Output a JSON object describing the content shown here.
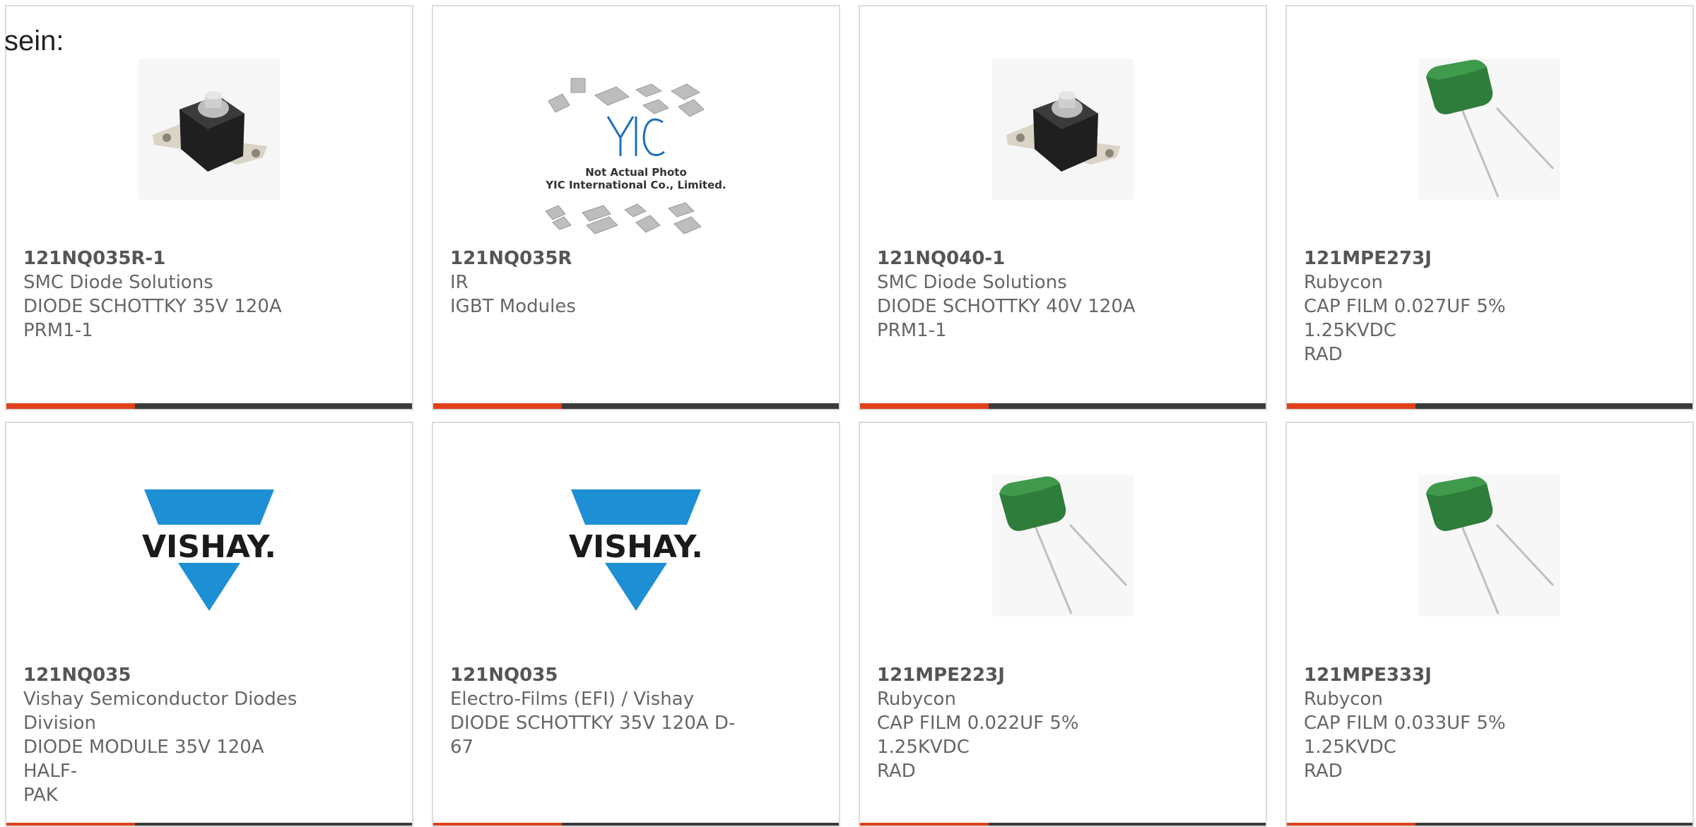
{
  "page": {
    "fragment_text": "sein:"
  },
  "products": [
    {
      "part_number": "121NQ035R-1",
      "manufacturer": "SMC Diode Solutions",
      "desc1": "DIODE SCHOTTKY 35V 120A",
      "desc2": "PRM1-1",
      "image": "diode-module-photo"
    },
    {
      "part_number": "121NQ035R",
      "manufacturer": "IR",
      "desc1": "IGBT Modules",
      "desc2": "",
      "image": "placeholder-photo",
      "image_caption": "Not Actual Photo",
      "image_caption2": "YIC International Co., Limited.",
      "image_logo": "YIC"
    },
    {
      "part_number": "121NQ040-1",
      "manufacturer": "SMC Diode Solutions",
      "desc1": "DIODE SCHOTTKY 40V 120A",
      "desc2": "PRM1-1",
      "image": "diode-module-photo"
    },
    {
      "part_number": "121MPE273J",
      "manufacturer": "Rubycon",
      "desc1": "CAP FILM 0.027UF 5% 1.25KVDC",
      "desc2": "RAD",
      "image": "film-capacitor-photo"
    },
    {
      "part_number": "121NQ035",
      "manufacturer": "Vishay Semiconductor Diodes",
      "manufacturer2": "Division",
      "desc1": "DIODE MODULE 35V 120A HALF-",
      "desc2": "PAK",
      "image": "vishay-logo",
      "logo_text": "VISHAY."
    },
    {
      "part_number": "121NQ035",
      "manufacturer": "Electro-Films (EFI) / Vishay",
      "desc1": "DIODE SCHOTTKY 35V 120A D-",
      "desc2": "67",
      "image": "vishay-logo",
      "logo_text": "VISHAY."
    },
    {
      "part_number": "121MPE223J",
      "manufacturer": "Rubycon",
      "desc1": "CAP FILM 0.022UF 5% 1.25KVDC",
      "desc2": "RAD",
      "image": "film-capacitor-photo"
    },
    {
      "part_number": "121MPE333J",
      "manufacturer": "Rubycon",
      "desc1": "CAP FILM 0.033UF 5% 1.25KVDC",
      "desc2": "RAD",
      "image": "film-capacitor-photo"
    }
  ],
  "colors": {
    "accent": "#e0401c",
    "bar": "#3a3a3a",
    "border": "#dcdcdc",
    "text": "#666666",
    "vishay_blue": "#1e8fd5",
    "capacitor_green": "#2e7d3a"
  }
}
